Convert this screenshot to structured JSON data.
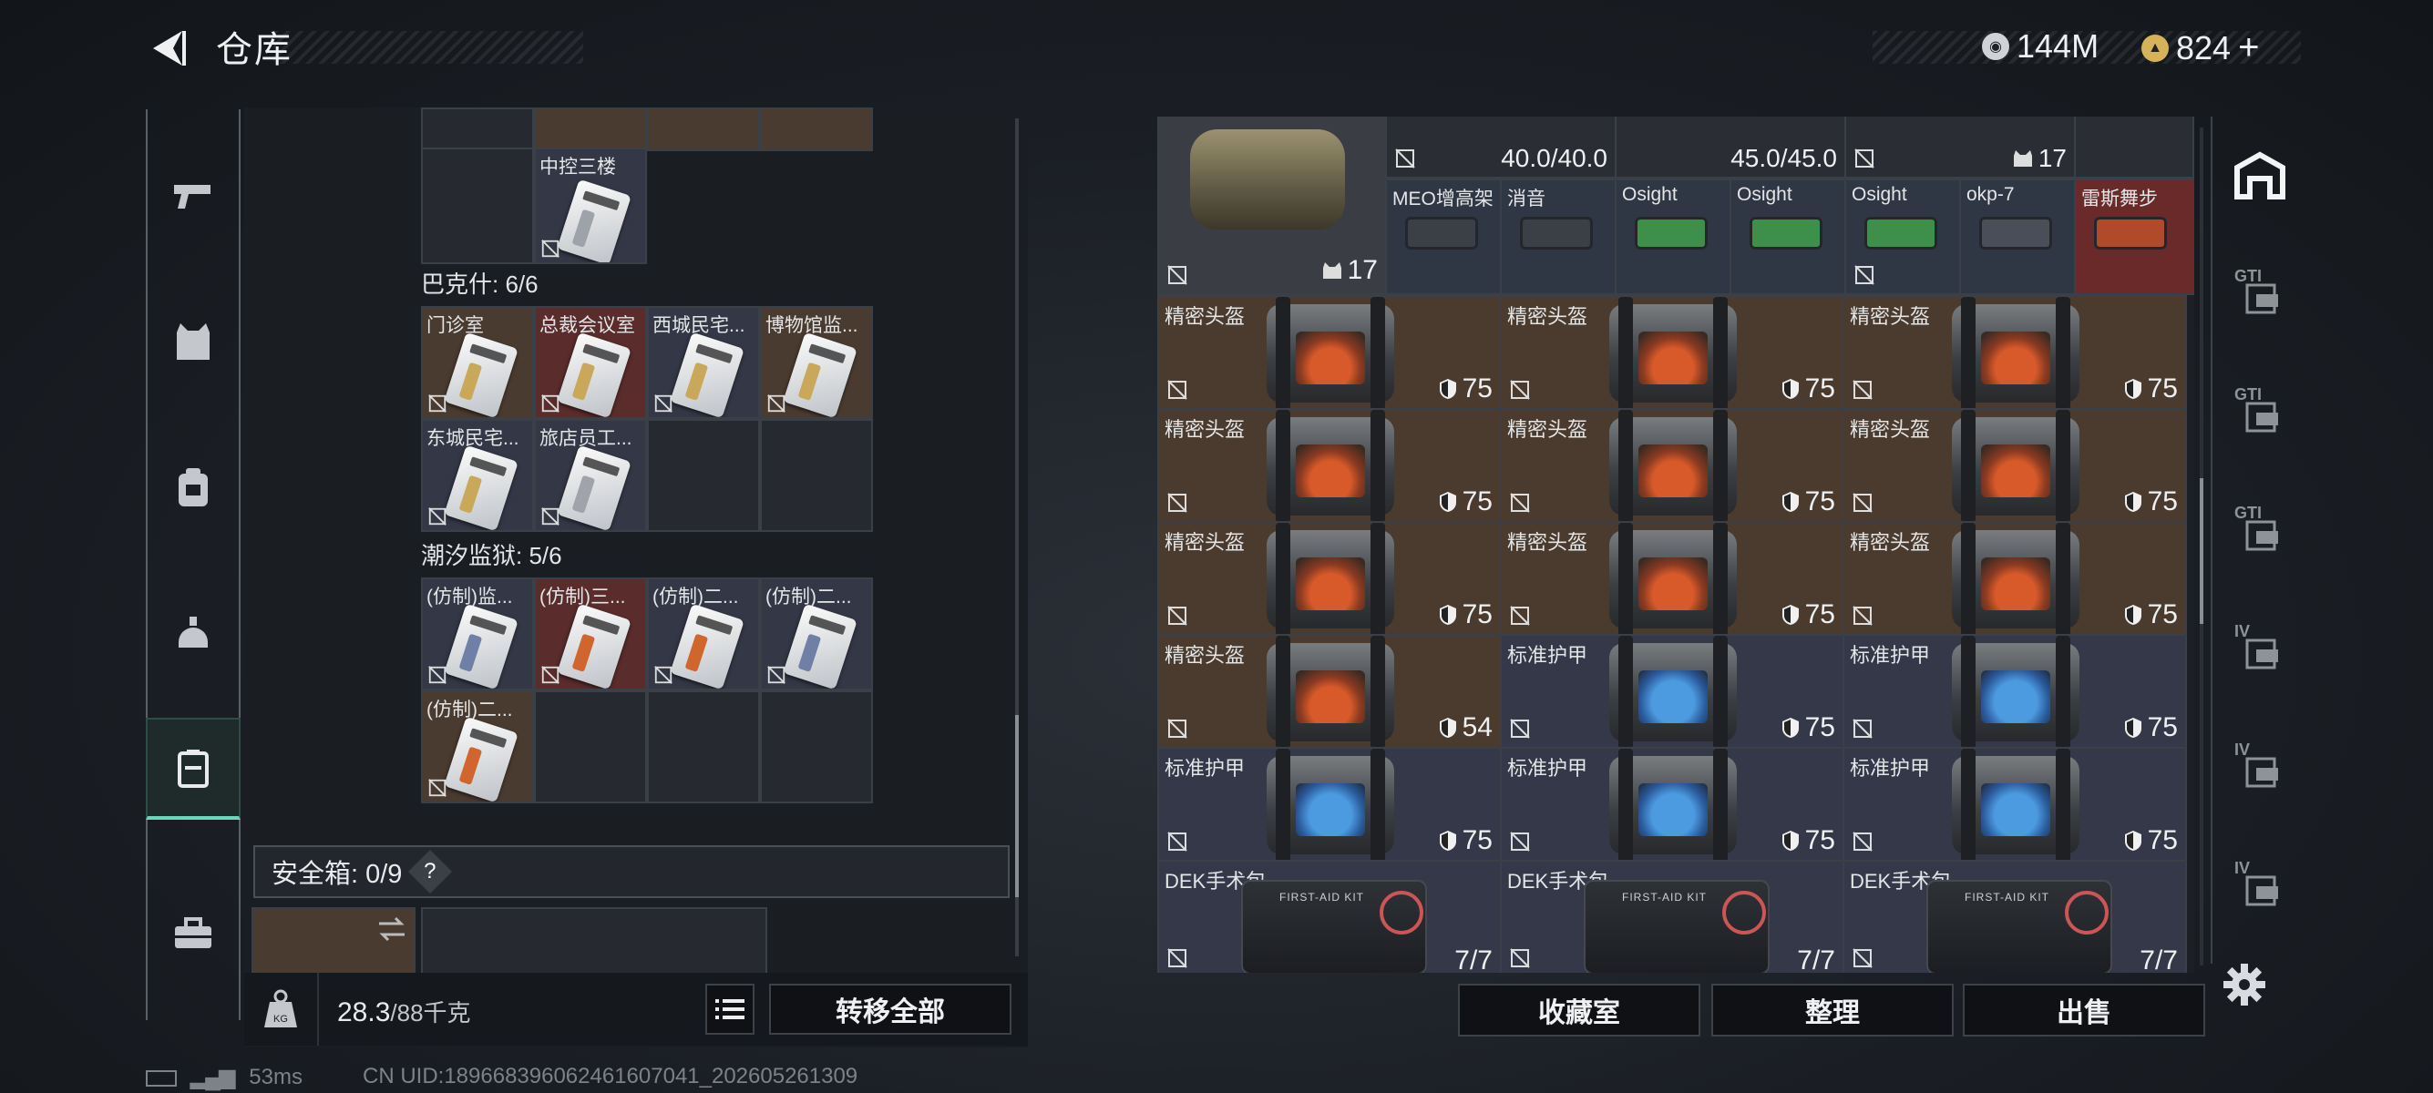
{
  "header": {
    "title": "仓库",
    "currency1": "144M",
    "currency2": "824",
    "plus": "+"
  },
  "left_nav": [
    "weapon-icon",
    "vest-icon",
    "backpack-icon",
    "helmet-icon",
    "case-icon",
    "toolbox-icon"
  ],
  "left": {
    "top_cells": [
      {
        "name": "中控三楼"
      }
    ],
    "section1": {
      "label": "巴克什: 6/6",
      "cells": [
        {
          "name": "门诊室",
          "tag": "#c9a85a",
          "bg": "brown"
        },
        {
          "name": "总裁会议室",
          "tag": "#c9a85a",
          "bg": "red"
        },
        {
          "name": "西城民宅...",
          "tag": "#c9a85a",
          "bg": "slate"
        },
        {
          "name": "博物馆监...",
          "tag": "#c9a85a",
          "bg": "brown"
        },
        {
          "name": "东城民宅...",
          "tag": "#c9a85a",
          "bg": "slate"
        },
        {
          "name": "旅店员工...",
          "tag": "#a0a4aa",
          "bg": "slate"
        }
      ]
    },
    "section2": {
      "label": "潮汐监狱: 5/6",
      "cells": [
        {
          "name": "(仿制)监...",
          "tag": "#6f7fa5",
          "bg": "slate"
        },
        {
          "name": "(仿制)三...",
          "tag": "#d0662e",
          "bg": "red"
        },
        {
          "name": "(仿制)二...",
          "tag": "#d0662e",
          "bg": "slate"
        },
        {
          "name": "(仿制)二...",
          "tag": "#6f7fa5",
          "bg": "slate"
        },
        {
          "name": "(仿制)二...",
          "tag": "#d0662e",
          "bg": "brown"
        }
      ]
    },
    "safe_box": {
      "label": "安全箱: 0/9",
      "help": "?"
    },
    "weight": {
      "value": "28.3",
      "unit": "/88千克"
    },
    "transfer_all": "转移全部"
  },
  "right": {
    "top_row": {
      "values": [
        "40.0/40.0",
        "45.0/45.0",
        "17"
      ],
      "bag_count": "17",
      "attachments": [
        {
          "name": "MEO增高架",
          "color": "#3a3f48"
        },
        {
          "name": "消音",
          "color": "#3a3f48"
        },
        {
          "name": "Osight",
          "color": "#3d8f4a"
        },
        {
          "name": "Osight",
          "color": "#3d8f4a"
        },
        {
          "name": "Osight",
          "color": "#3d8f4a"
        },
        {
          "name": "okp-7",
          "color": "#4a4e58"
        },
        {
          "name": "雷斯舞步",
          "color": "#b04a2a"
        }
      ]
    },
    "items": [
      {
        "name": "精密头盔",
        "dur": "75",
        "kind": "brown"
      },
      {
        "name": "精密头盔",
        "dur": "75",
        "kind": "brown"
      },
      {
        "name": "精密头盔",
        "dur": "75",
        "kind": "brown"
      },
      {
        "name": "精密头盔",
        "dur": "75",
        "kind": "brown"
      },
      {
        "name": "精密头盔",
        "dur": "75",
        "kind": "brown"
      },
      {
        "name": "精密头盔",
        "dur": "75",
        "kind": "brown"
      },
      {
        "name": "精密头盔",
        "dur": "75",
        "kind": "brown"
      },
      {
        "name": "精密头盔",
        "dur": "75",
        "kind": "brown"
      },
      {
        "name": "精密头盔",
        "dur": "75",
        "kind": "brown"
      },
      {
        "name": "精密头盔",
        "dur": "54",
        "kind": "brown"
      },
      {
        "name": "标准护甲",
        "dur": "75",
        "kind": "blue"
      },
      {
        "name": "标准护甲",
        "dur": "75",
        "kind": "blue"
      },
      {
        "name": "标准护甲",
        "dur": "75",
        "kind": "blue"
      },
      {
        "name": "标准护甲",
        "dur": "75",
        "kind": "blue"
      },
      {
        "name": "标准护甲",
        "dur": "75",
        "kind": "blue"
      }
    ],
    "medkits": [
      {
        "name": "DEK手术包",
        "count": "7/7",
        "label": "FIRST-AID KIT"
      },
      {
        "name": "DEK手术包",
        "count": "7/7",
        "label": "FIRST-AID KIT"
      },
      {
        "name": "DEK手术包",
        "count": "7/7",
        "label": "FIRST-AID KIT"
      }
    ],
    "buttons": {
      "collection": "收藏室",
      "sort": "整理",
      "sell": "出售"
    }
  },
  "right_nav": [
    "GTI",
    "GTI",
    "GTI",
    "IV",
    "IV",
    "IV"
  ],
  "footer": {
    "latency": "53ms",
    "uid": "CN UID:1896683960624616070​41_202605261309"
  }
}
